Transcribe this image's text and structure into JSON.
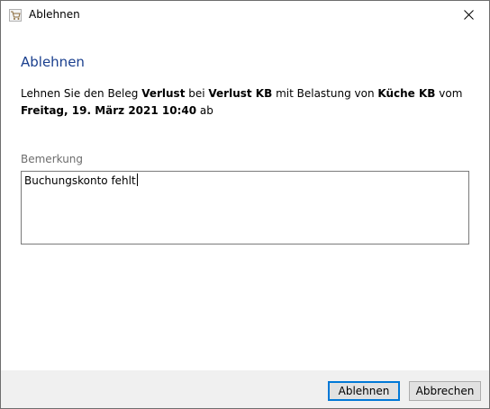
{
  "window": {
    "title": "Ablehnen",
    "icon": "cart-icon"
  },
  "dialog": {
    "heading": "Ablehnen",
    "message_parts": [
      {
        "text": "Lehnen Sie den Beleg ",
        "bold": false
      },
      {
        "text": "Verlust",
        "bold": true
      },
      {
        "text": " bei ",
        "bold": false
      },
      {
        "text": "Verlust KB",
        "bold": true
      },
      {
        "text": " mit Belastung von ",
        "bold": false
      },
      {
        "text": "Küche KB",
        "bold": true
      },
      {
        "text": " vom ",
        "bold": false
      },
      {
        "text": "Freitag, 19. März 2021 10:40",
        "bold": true
      },
      {
        "text": " ab",
        "bold": false
      }
    ],
    "remark_label": "Bemerkung",
    "remark_value": "Buchungskonto fehlt"
  },
  "buttons": {
    "reject_label": "Ablehnen",
    "cancel_label": "Abbrechen"
  },
  "colors": {
    "heading": "#1a3f8e",
    "footer_bg": "#f0f0f0",
    "primary_border": "#0078d7"
  }
}
